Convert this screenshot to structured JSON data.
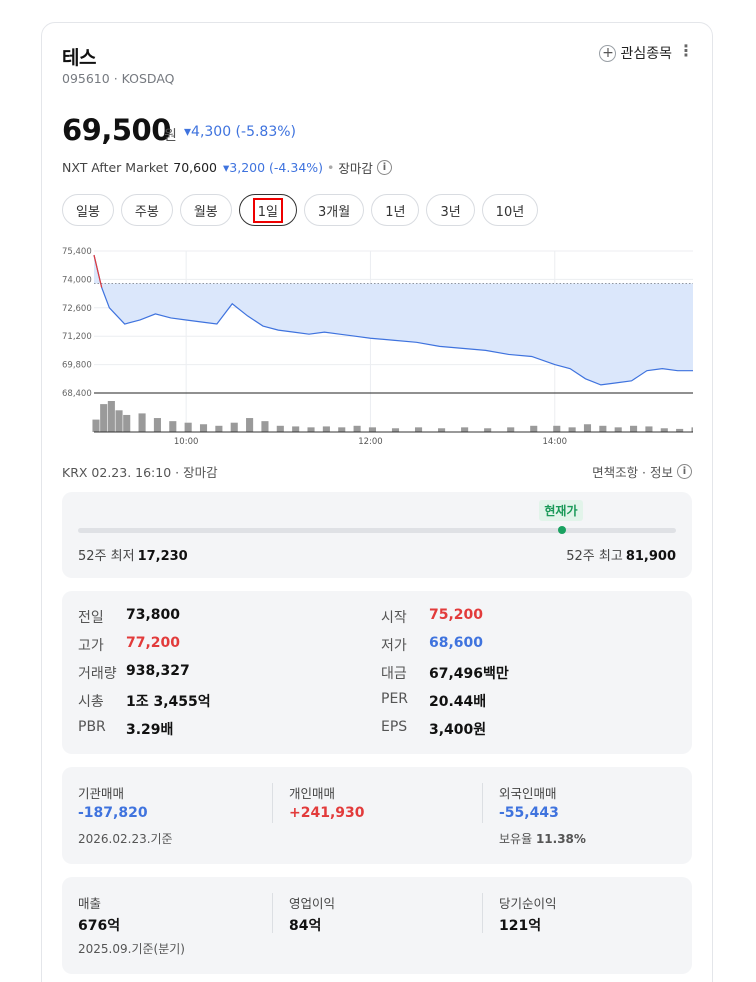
{
  "header": {
    "name": "테스",
    "code": "095610 · KOSDAQ",
    "favorite_label": "관심종목",
    "more_label": "⋮"
  },
  "quote": {
    "price": "69,500",
    "unit": "원",
    "change_arrow": "▾",
    "change": "4,300 (-5.83%)"
  },
  "nxt": {
    "label": "NXT After Market",
    "price": "70,600",
    "change": "▾3,200 (-4.34%)",
    "status": "장마감"
  },
  "periods": [
    "일봉",
    "주봉",
    "월봉",
    "1일",
    "3개월",
    "1년",
    "3년",
    "10년"
  ],
  "active_period": "1일",
  "chart_data": {
    "type": "area",
    "y_ticks": [
      "75,400",
      "74,000",
      "72,600",
      "71,200",
      "69,800",
      "68,400"
    ],
    "x_ticks": [
      "10:00",
      "12:00",
      "14:00"
    ],
    "ylim": [
      68400,
      75400
    ],
    "previous_close": 73800,
    "x": [
      "09:00",
      "09:05",
      "09:10",
      "09:15",
      "09:20",
      "09:30",
      "09:40",
      "09:50",
      "10:00",
      "10:10",
      "10:20",
      "10:30",
      "10:40",
      "10:50",
      "11:00",
      "11:10",
      "11:20",
      "11:30",
      "11:40",
      "11:50",
      "12:00",
      "12:15",
      "12:30",
      "12:45",
      "13:00",
      "13:15",
      "13:30",
      "13:45",
      "14:00",
      "14:10",
      "14:20",
      "14:30",
      "14:40",
      "14:50",
      "15:00",
      "15:10",
      "15:20",
      "15:30"
    ],
    "values": [
      75200,
      73600,
      72600,
      72200,
      71800,
      72000,
      72300,
      72100,
      72000,
      71900,
      71800,
      72800,
      72200,
      71700,
      71500,
      71400,
      71300,
      71400,
      71300,
      71200,
      71100,
      71000,
      70900,
      70700,
      70600,
      70500,
      70300,
      70200,
      69800,
      69600,
      69100,
      68800,
      68900,
      69000,
      69500,
      69600,
      69500,
      69500
    ],
    "volumes": [
      40,
      90,
      100,
      70,
      55,
      60,
      45,
      35,
      30,
      25,
      20,
      30,
      45,
      35,
      20,
      18,
      15,
      18,
      15,
      20,
      15,
      12,
      15,
      12,
      15,
      12,
      15,
      20,
      20,
      15,
      25,
      20,
      15,
      20,
      18,
      12,
      10,
      15
    ],
    "colors": {
      "up": "#e23b3b",
      "down": "#3f73de",
      "fill": "#dbe7fb"
    }
  },
  "chart_footer": {
    "left": "KRX 02.23. 16:10 · 장마감",
    "right": "면책조항 · 정보"
  },
  "range52": {
    "current_label": "현재가",
    "low_label": "52주 최저",
    "low": "17,230",
    "high_label": "52주 최고",
    "high": "81,900",
    "current_position": 0.81
  },
  "stats": [
    {
      "label": "전일",
      "value": "73,800",
      "tone": ""
    },
    {
      "label": "시작",
      "value": "75,200",
      "tone": "red"
    },
    {
      "label": "고가",
      "value": "77,200",
      "tone": "red"
    },
    {
      "label": "저가",
      "value": "68,600",
      "tone": "blue"
    },
    {
      "label": "거래량",
      "value": "938,327",
      "tone": ""
    },
    {
      "label": "대금",
      "value": "67,496백만",
      "tone": ""
    },
    {
      "label": "시총",
      "value": "1조 3,455억",
      "tone": ""
    },
    {
      "label": "PER",
      "value": "20.44배",
      "tone": ""
    },
    {
      "label": "PBR",
      "value": "3.29배",
      "tone": ""
    },
    {
      "label": "EPS",
      "value": "3,400원",
      "tone": ""
    }
  ],
  "flow": {
    "institution_label": "기관매매",
    "institution": "-187,820",
    "individual_label": "개인매매",
    "individual": "+241,930",
    "foreign_label": "외국인매매",
    "foreign": "-55,443",
    "date": "2026.02.23.기준",
    "holding_label": "보유율",
    "holding": "11.38%"
  },
  "financials": {
    "sales_label": "매출",
    "sales": "676억",
    "op_label": "영업이익",
    "op": "84억",
    "net_label": "당기순이익",
    "net": "121억",
    "date": "2025.09.기준(분기)"
  }
}
